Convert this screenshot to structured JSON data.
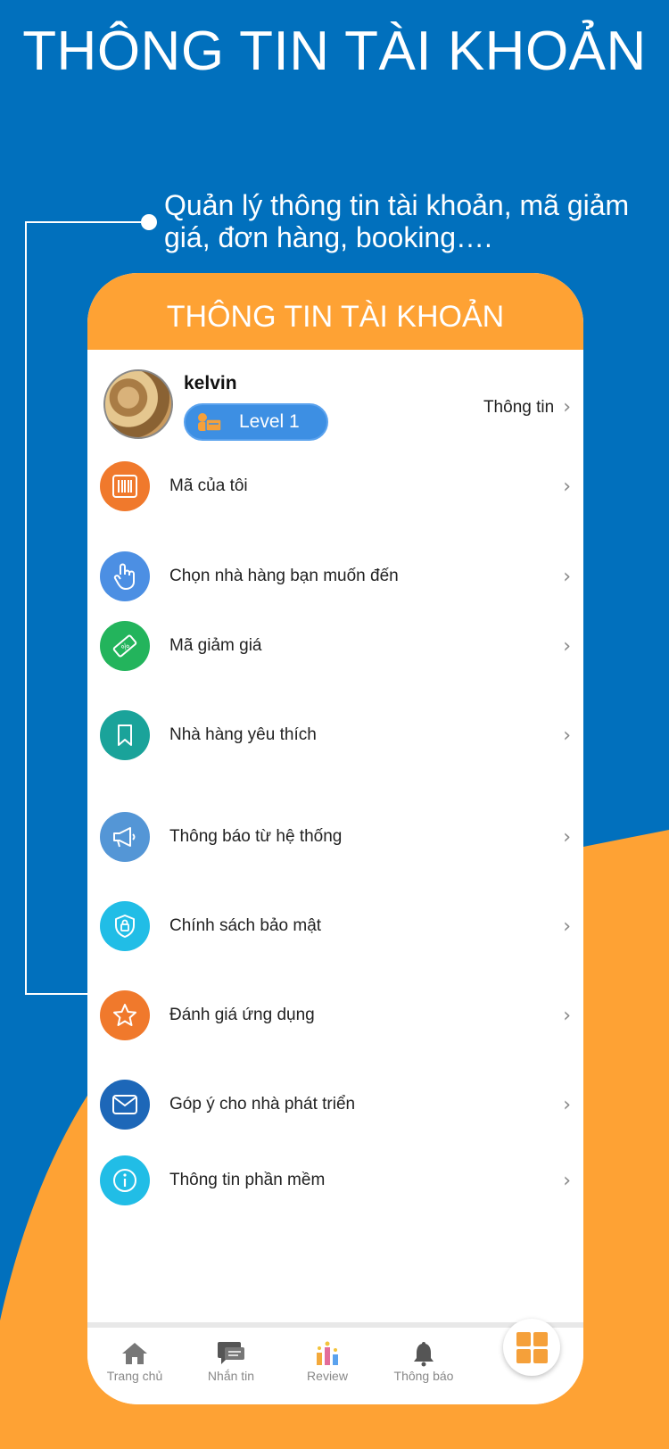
{
  "page": {
    "heading": "THÔNG TIN TÀI KHOẢN",
    "callout": "Quản lý thông tin tài khoản, mã giảm giá, đơn hàng, booking…."
  },
  "app": {
    "header_title": "THÔNG TIN TÀI KHOẢN",
    "profile": {
      "username": "kelvin",
      "level": "Level 1",
      "info_link": "Thông tin"
    },
    "menu": [
      {
        "label": "Mã của tôi",
        "icon": "barcode-icon",
        "color": "#f0792c"
      },
      {
        "label": "Chọn nhà hàng bạn muốn đến",
        "icon": "pointer-hand-icon",
        "color": "#4c8fe3"
      },
      {
        "label": "Mã giảm giá",
        "icon": "ticket-icon",
        "color": "#23b45c"
      },
      {
        "label": "Nhà hàng yêu thích",
        "icon": "bookmark-icon",
        "color": "#1aa39a"
      },
      {
        "label": "Thông báo từ hệ thống",
        "icon": "megaphone-icon",
        "color": "#5496d6"
      },
      {
        "label": "Chính sách bảo mật",
        "icon": "shield-icon",
        "color": "#21bde6"
      },
      {
        "label": "Đánh giá ứng dụng",
        "icon": "star-icon",
        "color": "#f0792c"
      },
      {
        "label": "Góp ý cho nhà phát triển",
        "icon": "mail-icon",
        "color": "#1d67b8"
      },
      {
        "label": "Thông tin phần mềm",
        "icon": "info-icon",
        "color": "#21bde6"
      }
    ],
    "bottom_nav": [
      {
        "label": "Trang chủ",
        "icon": "home-icon"
      },
      {
        "label": "Nhắn tin",
        "icon": "chat-icon"
      },
      {
        "label": "Review",
        "icon": "review-icon"
      },
      {
        "label": "Thông báo",
        "icon": "bell-icon"
      }
    ]
  },
  "colors": {
    "background_blue": "#0170bd",
    "accent_orange": "#fea234"
  }
}
